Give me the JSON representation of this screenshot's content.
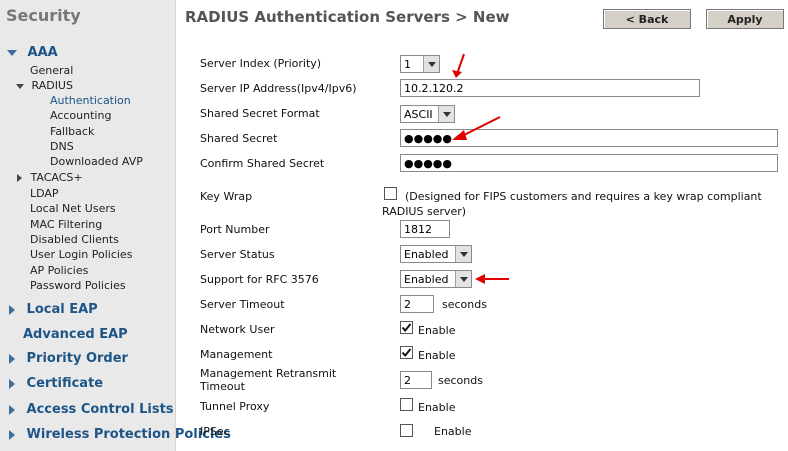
{
  "sidebar": {
    "title": "Security",
    "aaa": "AAA",
    "general": "General",
    "radius": "RADIUS",
    "radius_items": [
      "Authentication",
      "Accounting",
      "Fallback",
      "DNS",
      "Downloaded AVP"
    ],
    "tacacs": "TACACS+",
    "aaa_items": [
      "LDAP",
      "Local Net Users",
      "MAC Filtering",
      "Disabled Clients",
      "User Login Policies",
      "AP Policies",
      "Password Policies"
    ],
    "sections": [
      "Local EAP",
      "Advanced EAP",
      "Priority Order",
      "Certificate",
      "Access Control Lists",
      "Wireless Protection Policies"
    ]
  },
  "header": {
    "title": "RADIUS Authentication Servers > New",
    "back_label": "< Back",
    "apply_label": "Apply"
  },
  "form": {
    "server_index": {
      "label": "Server Index (Priority)",
      "value": "1"
    },
    "server_ip": {
      "label": "Server IP Address(Ipv4/Ipv6)",
      "value": "10.2.120.2"
    },
    "secret_format": {
      "label": "Shared Secret Format",
      "value": "ASCII"
    },
    "shared_secret": {
      "label": "Shared Secret",
      "value": "●●●●●"
    },
    "confirm_secret": {
      "label": "Confirm Shared Secret",
      "value": "●●●●●"
    },
    "key_wrap": {
      "label": "Key Wrap",
      "checked": false,
      "note_line1": "(Designed for FIPS customers and requires a key wrap compliant",
      "note_line2": "RADIUS server)"
    },
    "port_number": {
      "label": "Port Number",
      "value": "1812"
    },
    "server_status": {
      "label": "Server Status",
      "value": "Enabled"
    },
    "rfc3576": {
      "label": "Support for RFC 3576",
      "value": "Enabled"
    },
    "server_timeout": {
      "label": "Server Timeout",
      "value": "2",
      "unit": "seconds"
    },
    "network_user": {
      "label": "Network User",
      "checked": true,
      "text": "Enable"
    },
    "management": {
      "label": "Management",
      "checked": true,
      "text": "Enable"
    },
    "mgmt_retransmit": {
      "label_line1": "Management Retransmit",
      "label_line2": "Timeout",
      "value": "2",
      "unit": "seconds"
    },
    "tunnel_proxy": {
      "label": "Tunnel Proxy",
      "checked": false,
      "text": "Enable"
    },
    "ipsec": {
      "label": "IPSec",
      "checked": false,
      "text": "Enable"
    }
  },
  "colors": {
    "nav_blue": "#1d5587",
    "annotation_red": "#e00000"
  }
}
